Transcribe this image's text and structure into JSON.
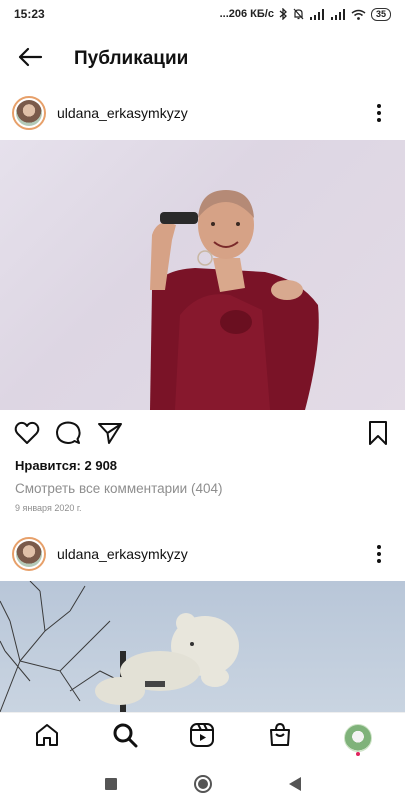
{
  "status_bar": {
    "time": "15:23",
    "speed": "...206 КБ/с",
    "battery": "35"
  },
  "header": {
    "title": "Публикации"
  },
  "posts": [
    {
      "username": "uldana_erkasymkyzy",
      "likes": "Нравится: 2 908",
      "comments_link": "Смотреть все комментарии (404)",
      "date": "9 января 2020 г."
    },
    {
      "username": "uldana_erkasymkyzy"
    }
  ],
  "icons": {
    "back": "arrow-left-icon",
    "more": "more-vertical-icon",
    "like": "heart-icon",
    "comment": "comment-icon",
    "share": "send-icon",
    "save": "bookmark-icon",
    "home": "home-icon",
    "search": "search-icon",
    "reels": "reels-icon",
    "shop": "shop-icon"
  },
  "colors": {
    "accent_ring": "#e7a06a",
    "secondary_text": "#8e8e8e",
    "notification_dot": "#e0245e"
  }
}
